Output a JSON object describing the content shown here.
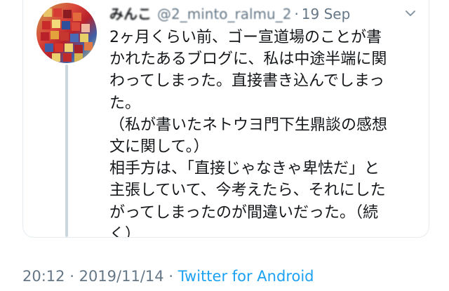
{
  "tweet": {
    "display_name": "みんこ",
    "handle": "@2_minto_ralmu_2",
    "separator": "·",
    "time_ago": "19 Sep",
    "body_lines": [
      "2ヶ月くらい前、ゴー宣道場のことが書",
      "かれたあるブログに、私は中途半端に関",
      "わってしまった。直接書き込んでしまっ",
      "た。",
      "（私が書いたネトウヨ門下生鼎談の感想",
      "文に関して。）",
      "相手方は、「直接じゃなきゃ卑怯だ」と",
      "主張していて、今考えたら、それにした",
      "がってしまったのが間違いだった。（続",
      "く）"
    ]
  },
  "meta": {
    "time": "20:12",
    "separator1": "·",
    "date": "2019/11/14",
    "separator2": "·",
    "source": "Twitter for Android"
  },
  "colors": {
    "text": "#14171a",
    "secondary": "#657786",
    "link": "#1da1f2",
    "thread_line": "#ccd6dd"
  },
  "icons": {
    "caret": "chevron-down-icon",
    "avatar": "avatar"
  }
}
